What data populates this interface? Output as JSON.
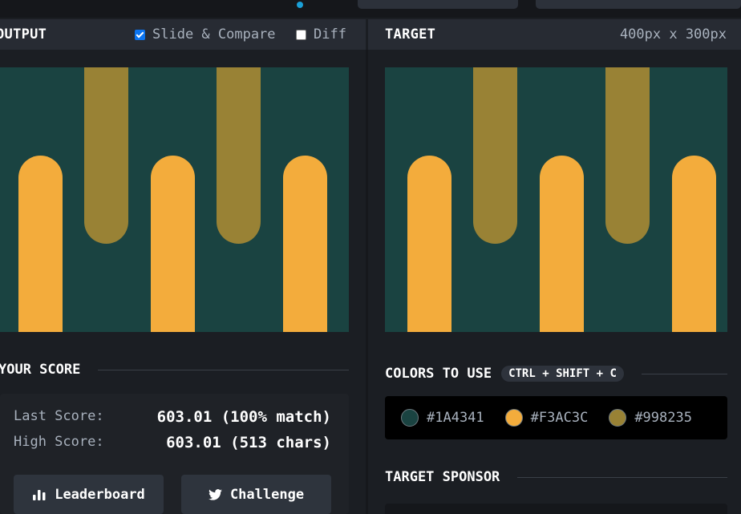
{
  "output_header": {
    "title": "OUTPUT",
    "slide_compare_label": "Slide & Compare",
    "slide_compare_checked": true,
    "diff_label": "Diff",
    "diff_checked": false
  },
  "target_header": {
    "title": "TARGET",
    "dimensions": "400px x 300px"
  },
  "canvas_colors": {
    "background": "#1A4341",
    "short_bar": "#F3AC3C",
    "tall_bar": "#998235"
  },
  "score": {
    "section_title": "YOUR SCORE",
    "last_label": "Last Score:",
    "last_value": "603.01 (100% match)",
    "high_label": "High Score:",
    "high_value": "603.01 (513 chars)",
    "leaderboard_label": "Leaderboard",
    "challenge_label": "Challenge"
  },
  "colors": {
    "section_title": "COLORS TO USE",
    "shortcut": "CTRL + SHIFT + C",
    "items": [
      {
        "hex": "#1A4341"
      },
      {
        "hex": "#F3AC3C"
      },
      {
        "hex": "#998235"
      }
    ]
  },
  "sponsor": {
    "section_title": "TARGET SPONSOR"
  },
  "icons": {
    "leaderboard": "bar-chart-icon",
    "challenge": "twitter-icon"
  }
}
